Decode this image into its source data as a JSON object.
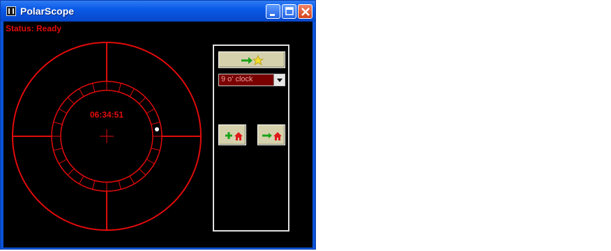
{
  "window": {
    "title": "PolarScope"
  },
  "status": {
    "text": "Status: Ready"
  },
  "scope": {
    "time": "06:34:51"
  },
  "controls": {
    "hour_select": {
      "selected": "9 o' clock"
    },
    "goto_star_icon": "arrow-to-star-icon",
    "add_home_icon": "plus-home-icon",
    "goto_home_icon": "arrow-to-home-icon"
  },
  "colors": {
    "reticle": "#e30b0b",
    "background": "#000000",
    "titlebar": "#0a5ae8"
  }
}
